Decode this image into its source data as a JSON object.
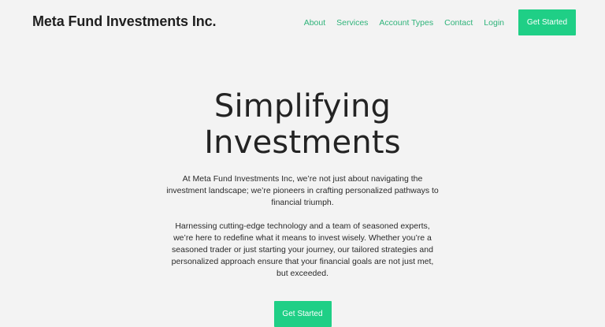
{
  "header": {
    "brand": "Meta Fund Investments Inc.",
    "nav": {
      "about": "About",
      "services": "Services",
      "account_types": "Account Types",
      "contact": "Contact",
      "login": "Login",
      "get_started": "Get Started"
    }
  },
  "hero": {
    "title_line1": "Simplifying",
    "title_line2": "Investments",
    "paragraph1": "At Meta Fund Investments Inc, we’re not just about navigating the investment landscape; we’re pioneers in crafting personalized pathways to financial triumph.",
    "paragraph2": "Harnessing cutting-edge technology and a team of seasoned experts, we’re here to redefine what it means to invest wisely. Whether you’re a seasoned trader or just starting your journey, our tailored strategies and personalized approach ensure that your financial goals are not just met, but exceeded.",
    "cta": "Get Started"
  },
  "colors": {
    "background": "#f3f3f3",
    "accent": "#1fcf86",
    "nav_link": "#2fb37a",
    "text": "#222222"
  }
}
